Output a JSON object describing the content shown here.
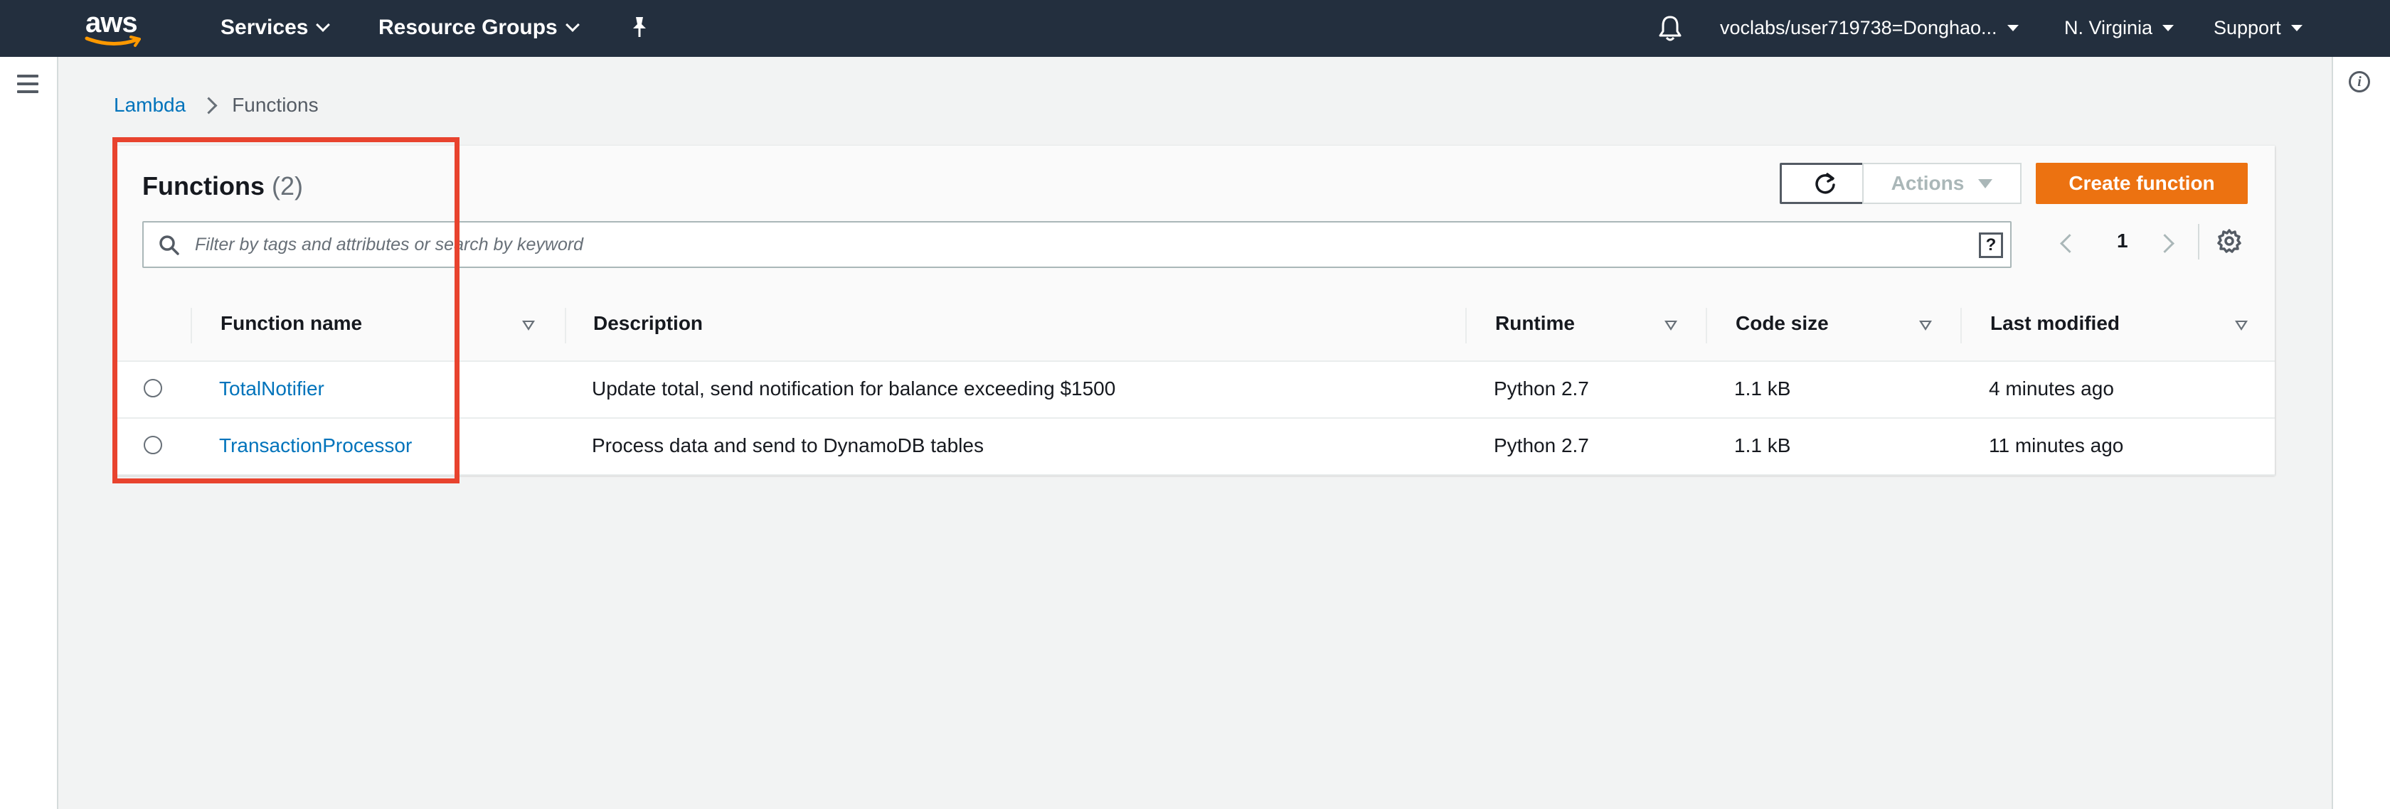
{
  "topnav": {
    "logo_text": "aws",
    "services": "Services",
    "resource_groups": "Resource Groups",
    "account": "voclabs/user719738=Donghao...",
    "region": "N. Virginia",
    "support": "Support"
  },
  "breadcrumb": {
    "root": "Lambda",
    "current": "Functions"
  },
  "panel": {
    "title": "Functions",
    "count": "(2)",
    "actions_label": "Actions",
    "create_label": "Create function",
    "search_placeholder": "Filter by tags and attributes or search by keyword",
    "page_number": "1"
  },
  "table": {
    "headers": {
      "name": "Function name",
      "description": "Description",
      "runtime": "Runtime",
      "code_size": "Code size",
      "last_modified": "Last modified"
    },
    "rows": [
      {
        "name": "TotalNotifier",
        "description": "Update total, send notification for balance exceeding $1500",
        "runtime": "Python 2.7",
        "code_size": "1.1 kB",
        "last_modified": "4 minutes ago"
      },
      {
        "name": "TransactionProcessor",
        "description": "Process data and send to DynamoDB tables",
        "runtime": "Python 2.7",
        "code_size": "1.1 kB",
        "last_modified": "11 minutes ago"
      }
    ]
  },
  "colors": {
    "nav_bg": "#232f3e",
    "primary_button": "#ec7211",
    "link": "#0073bb",
    "highlight": "#e8432e"
  }
}
